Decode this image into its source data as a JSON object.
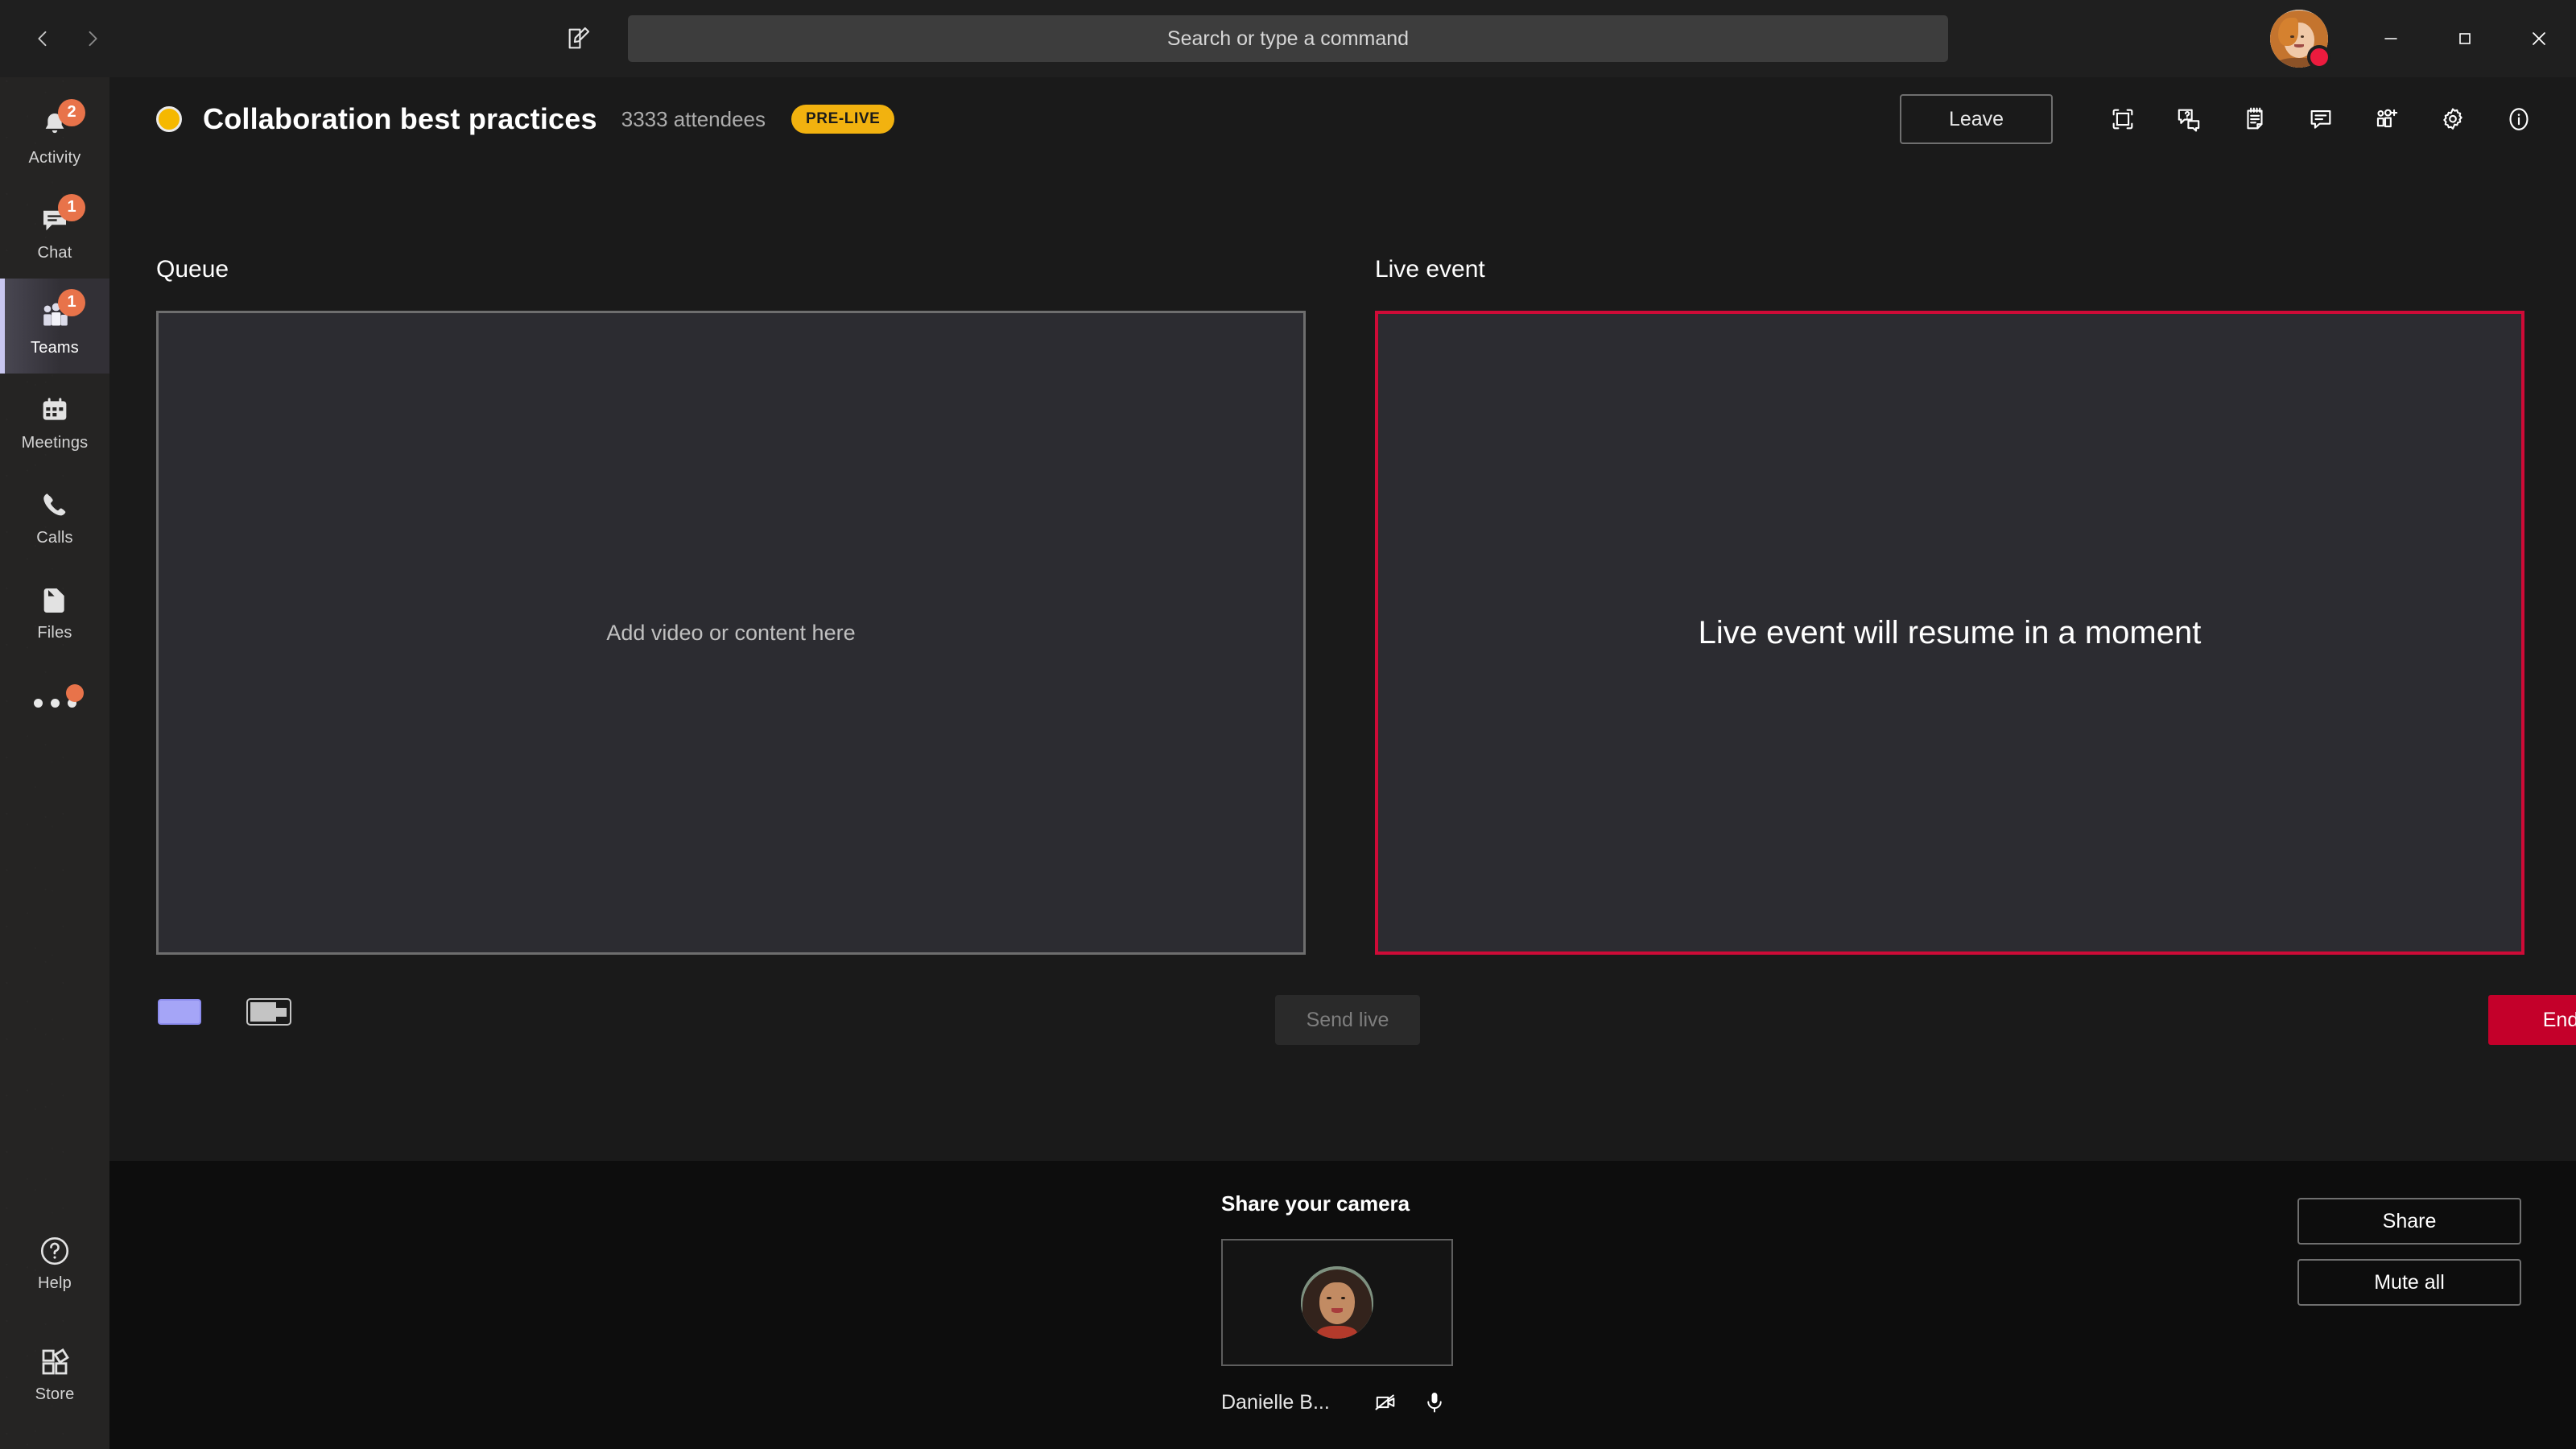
{
  "titlebar": {
    "back_icon": "chevron-left-icon",
    "forward_icon": "chevron-right-icon",
    "compose_icon": "compose-icon",
    "search": {
      "value": "",
      "placeholder": "Search or type a command"
    },
    "avatar_name": "user-avatar",
    "presence": "busy",
    "minimize_label": "Minimize",
    "maximize_label": "Maximize",
    "close_label": "Close"
  },
  "sidebar": {
    "items": [
      {
        "label": "Activity",
        "icon": "bell-icon",
        "badge": "2",
        "active": false
      },
      {
        "label": "Chat",
        "icon": "chat-icon",
        "badge": "1",
        "active": false
      },
      {
        "label": "Teams",
        "icon": "teams-icon",
        "badge": "1",
        "active": true
      },
      {
        "label": "Meetings",
        "icon": "calendar-icon",
        "badge": "",
        "active": false
      },
      {
        "label": "Calls",
        "icon": "phone-icon",
        "badge": "",
        "active": false
      },
      {
        "label": "Files",
        "icon": "files-icon",
        "badge": "",
        "active": false
      }
    ],
    "more_icon": "more-horizontal-icon",
    "more_has_badge": true,
    "bottom_items": [
      {
        "label": "Help",
        "icon": "help-circle-icon"
      },
      {
        "label": "Store",
        "icon": "store-icon"
      }
    ]
  },
  "event_header": {
    "status_dot": "pre-live-dot",
    "title": "Collaboration best practices",
    "attendees": "3333 attendees",
    "badge": "PRE-LIVE",
    "leave_label": "Leave",
    "toolbar_icons": [
      "full-screen-icon",
      "qna-icon",
      "notes-icon",
      "chat-icon",
      "add-people-icon",
      "gear-icon",
      "info-icon"
    ]
  },
  "queue": {
    "label": "Queue",
    "placeholder": "Add video or content here",
    "layout_swatch_color": "#A5A5F7",
    "layout_pip_icon": "layout-pip-icon",
    "send_live_label": "Send live",
    "send_live_disabled": true
  },
  "live_event": {
    "label": "Live event",
    "message": "Live event will resume in a moment",
    "border_color": "#CE0B37",
    "end_label": "End"
  },
  "bottom_bar": {
    "share_camera_title": "Share your camera",
    "participant_name": "Danielle B...",
    "camera_icon": "camera-off-icon",
    "mic_icon": "microphone-icon",
    "share_label": "Share",
    "mute_all_label": "Mute all"
  },
  "colors": {
    "accent": "#6264A7",
    "badge_yellow": "#F2B20F",
    "end_red": "#C4002A",
    "live_border": "#CE0B37",
    "notification_orange": "#E8734A"
  }
}
